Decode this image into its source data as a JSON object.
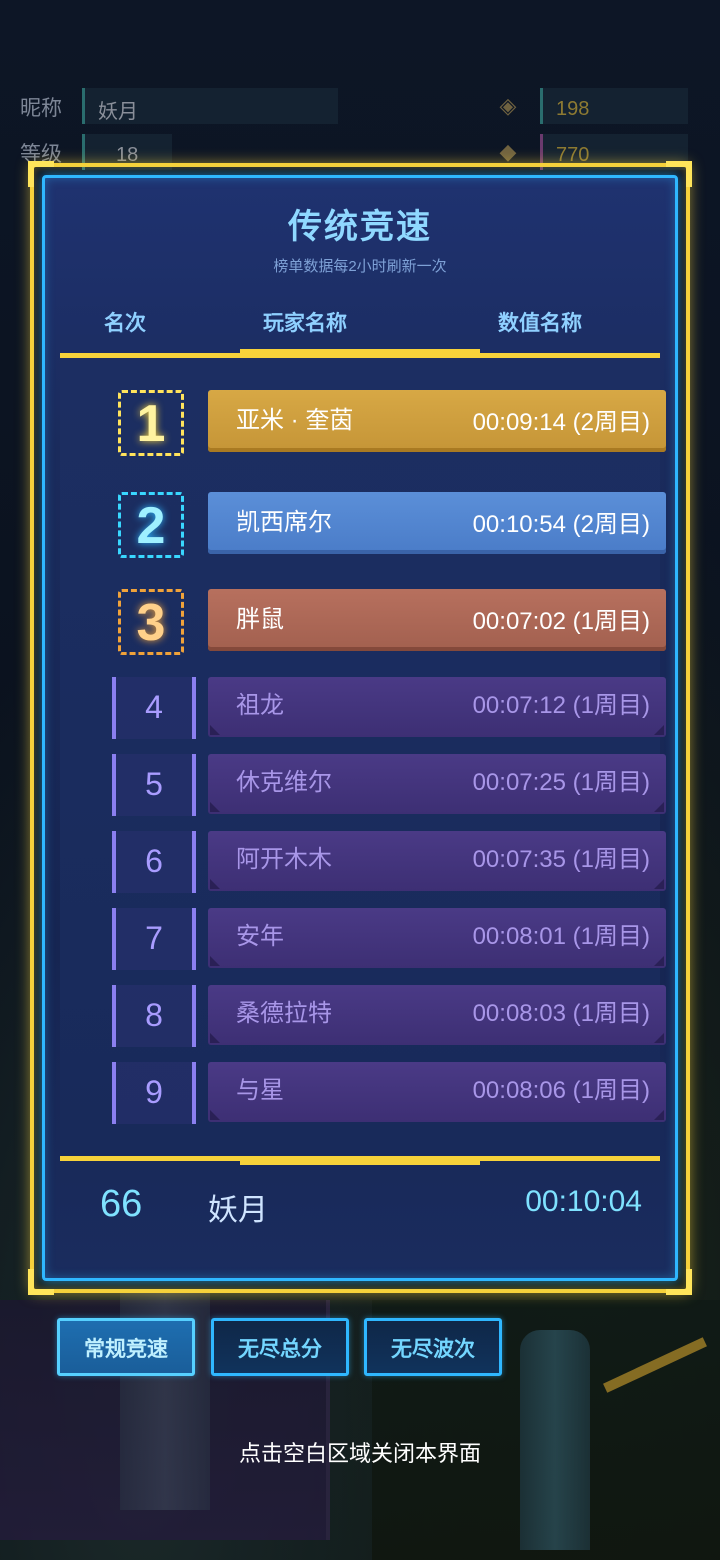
{
  "profile": {
    "nickname_label": "昵称",
    "nickname_value": "妖月",
    "level_label": "等级",
    "level_value": "18",
    "currency1_value": "198",
    "currency2_value": "770"
  },
  "dialog": {
    "title": "传统竞速",
    "subtitle": "榜单数据每2小时刷新一次",
    "columns": {
      "rank": "名次",
      "player": "玩家名称",
      "value": "数值名称"
    }
  },
  "rows": [
    {
      "rank": "1",
      "name": "亚米 · 奎茵",
      "value": "00:09:14 (2周目)"
    },
    {
      "rank": "2",
      "name": "凯西席尔",
      "value": "00:10:54 (2周目)"
    },
    {
      "rank": "3",
      "name": "胖鼠",
      "value": "00:07:02 (1周目)"
    },
    {
      "rank": "4",
      "name": "祖龙",
      "value": "00:07:12 (1周目)"
    },
    {
      "rank": "5",
      "name": "休克维尔",
      "value": "00:07:25 (1周目)"
    },
    {
      "rank": "6",
      "name": "阿开木木",
      "value": "00:07:35 (1周目)"
    },
    {
      "rank": "7",
      "name": "安年",
      "value": "00:08:01 (1周目)"
    },
    {
      "rank": "8",
      "name": "桑德拉特",
      "value": "00:08:03 (1周目)"
    },
    {
      "rank": "9",
      "name": "与星",
      "value": "00:08:06 (1周目)"
    }
  ],
  "my_entry": {
    "rank": "66",
    "name": "妖月",
    "value": "00:10:04"
  },
  "tabs": [
    {
      "label": "常规竞速",
      "active": true
    },
    {
      "label": "无尽总分",
      "active": false
    },
    {
      "label": "无尽波次",
      "active": false
    }
  ],
  "close_hint": "点击空白区域关闭本界面",
  "colors": {
    "frame_gold": "#f7d23a",
    "frame_cyan": "#2fb7ff",
    "rank1_bar": "#c59537",
    "rank2_bar": "#4a7cc8",
    "rank3_bar": "#a2604f",
    "other_bar": "#3d2f74"
  }
}
